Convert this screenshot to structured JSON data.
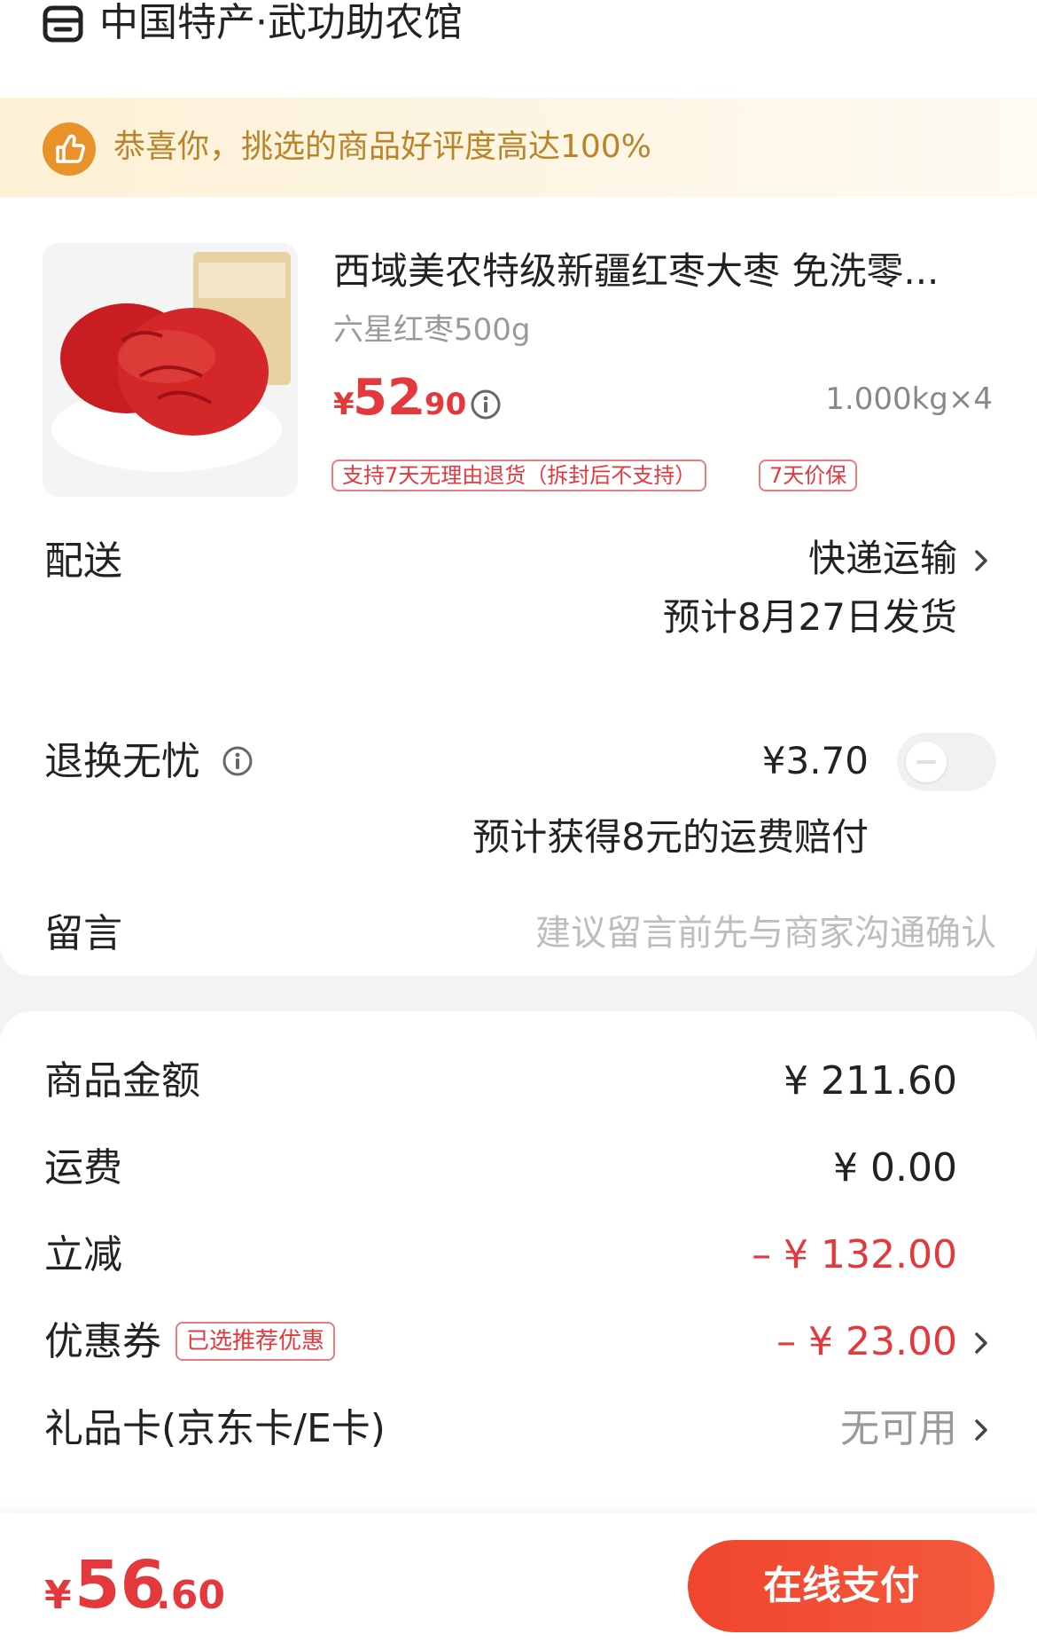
{
  "store": {
    "name": "中国特产·武功助农馆",
    "icon": "store-icon"
  },
  "banner": {
    "text": "恭喜你，挑选的商品好评度高达100%",
    "icon": "thumbs-up-icon"
  },
  "product": {
    "title": "西域美农特级新疆红枣大枣 免洗零...",
    "spec": "六星红枣500g",
    "price_currency": "¥",
    "price_int": "52",
    "price_dec": ".90",
    "quantity": "1.000kg×4",
    "tags": [
      "支持7天无理由退货（拆封后不支持）",
      "7天价保"
    ]
  },
  "delivery": {
    "label": "配送",
    "method": "快递运输",
    "date": "预计8月27日发货"
  },
  "return_service": {
    "label": "退换无忧",
    "price": "¥3.70",
    "desc": "预计获得8元的运费赔付",
    "enabled": false
  },
  "message": {
    "label": "留言",
    "placeholder": "建议留言前先与商家沟通确认",
    "value": ""
  },
  "summary": {
    "goods_amount": {
      "label": "商品金额",
      "value": "¥ 211.60"
    },
    "shipping": {
      "label": "运费",
      "value": "¥ 0.00"
    },
    "discount": {
      "label": "立减",
      "value": "– ¥ 132.00"
    },
    "coupon": {
      "label": "优惠券",
      "tag": "已选推荐优惠",
      "value": "– ¥ 23.00"
    },
    "gift_card": {
      "label": "礼品卡(京东卡/E卡)",
      "value": "无可用"
    }
  },
  "footer": {
    "total_currency": "¥",
    "total_int": "56",
    "total_dec": ".60",
    "pay_label": "在线支付"
  },
  "colors": {
    "accent": "#e4393c",
    "pay_button": "#f0452f",
    "banner_text": "#b98528",
    "banner_bg": "#fdf1d6"
  }
}
